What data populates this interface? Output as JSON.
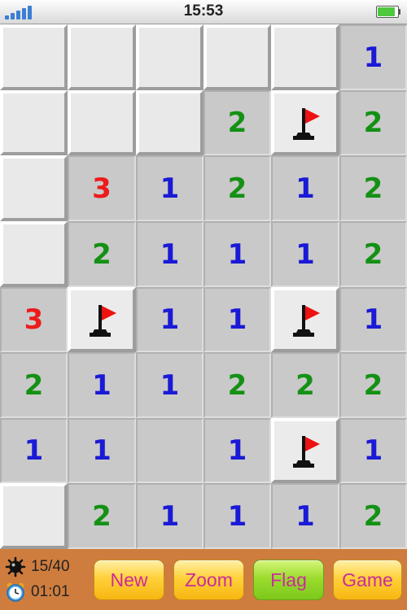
{
  "status_bar": {
    "time": "15:53"
  },
  "board": {
    "rows": 8,
    "cols": 6,
    "colors": {
      "1": "#1a1ad6",
      "2": "#149114",
      "3": "#ee1b1b"
    },
    "grid": [
      [
        "",
        "",
        "",
        "",
        "",
        "1"
      ],
      [
        "",
        "",
        "",
        "2",
        "F",
        "2"
      ],
      [
        "",
        "3",
        "1",
        "2",
        "1",
        "2"
      ],
      [
        "",
        "2",
        "1",
        "1",
        "1",
        "2"
      ],
      [
        "3",
        "F",
        "1",
        "1",
        "F",
        "1"
      ],
      [
        "2",
        "1",
        "1",
        "2",
        "2",
        "2"
      ],
      [
        "1",
        "1",
        "0",
        "1",
        "F",
        "1"
      ],
      [
        "",
        "2",
        "1",
        "1",
        "1",
        "2"
      ]
    ]
  },
  "toolbar": {
    "mines_counter": "15/40",
    "timer": "01:01",
    "buttons": {
      "new": "New",
      "zoom": "Zoom",
      "flag": "Flag",
      "game": "Game"
    },
    "active_mode": "flag"
  }
}
